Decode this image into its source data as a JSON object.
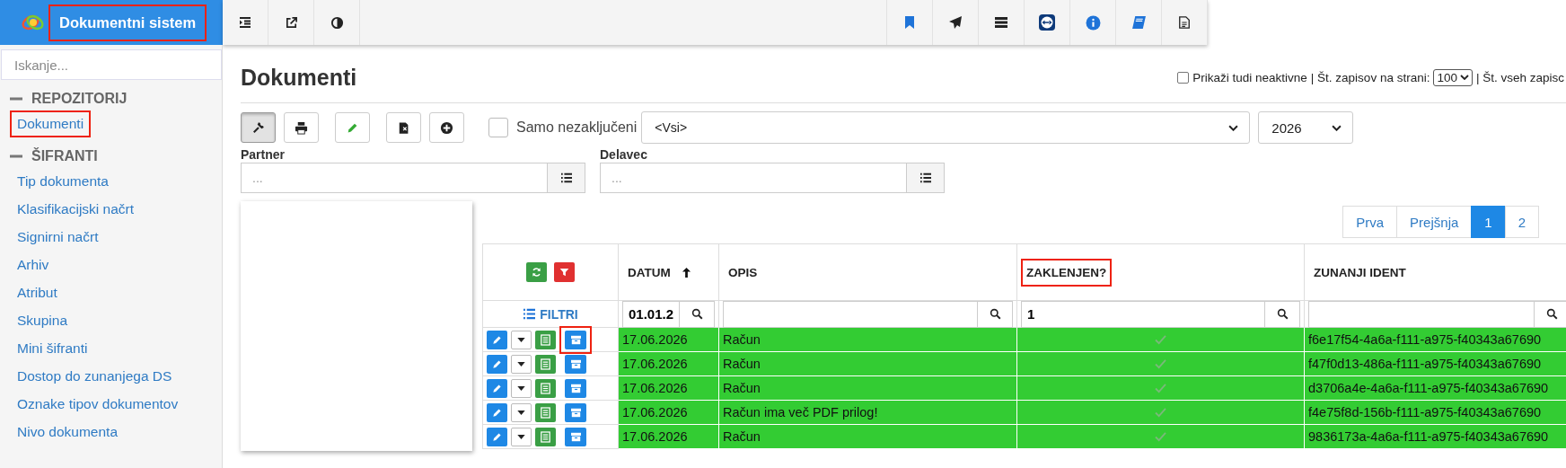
{
  "brand": {
    "title": "Dokumentni sistem",
    "highlighted": true
  },
  "sidebar": {
    "search_placeholder": "Iskanje...",
    "sections": [
      {
        "title": "REPOZITORIJ",
        "expanded": true,
        "items": [
          {
            "label": "Dokumenti",
            "highlighted": true
          }
        ]
      },
      {
        "title": "ŠIFRANTI",
        "expanded": true,
        "items": [
          {
            "label": "Tip dokumenta",
            "highlighted": false
          },
          {
            "label": "Klasifikacijski načrt",
            "highlighted": false
          },
          {
            "label": "Signirni načrt",
            "highlighted": false
          },
          {
            "label": "Arhiv",
            "highlighted": false
          },
          {
            "label": "Atribut",
            "highlighted": false
          },
          {
            "label": "Skupina",
            "highlighted": false
          },
          {
            "label": "Mini šifranti",
            "highlighted": false
          },
          {
            "label": "Dostop do zunanjega DS",
            "highlighted": false
          },
          {
            "label": "Oznake tipov dokumentov",
            "highlighted": false
          },
          {
            "label": "Nivo dokumenta",
            "highlighted": false
          }
        ]
      }
    ]
  },
  "page": {
    "title": "Dokumenti",
    "show_inactive": {
      "label": "Prikaži tudi neaktivne",
      "checked": false
    },
    "per_page_label": "| Št. zapisov na strani:",
    "per_page": "100",
    "total_label": "| Št. vseh zapisc"
  },
  "toolbar": {
    "only_unfinished": {
      "label": "Samo nezaključeni",
      "checked": false
    },
    "type_select": "<Vsi>",
    "year_select": "2026"
  },
  "filters": [
    {
      "label": "Partner",
      "placeholder": "..."
    },
    {
      "label": "Delavec",
      "placeholder": "..."
    }
  ],
  "pagination": [
    {
      "label": "Prva",
      "selected": false
    },
    {
      "label": "Prejšnja",
      "selected": false
    },
    {
      "label": "1",
      "selected": true
    },
    {
      "label": "2",
      "selected": false
    }
  ],
  "table": {
    "filter_label": "FILTRI",
    "columns": [
      {
        "label": "DATUM",
        "sort_ascending": true,
        "highlighted": false,
        "filter": "01.01.2"
      },
      {
        "label": "OPIS",
        "highlighted": false
      },
      {
        "label": "ZAKLENJEN?",
        "highlighted": true,
        "filter": "1"
      },
      {
        "label": "ZUNANJI IDENT",
        "highlighted": false
      }
    ],
    "rows": [
      {
        "date": "17.06.2026",
        "description": "Račun",
        "locked": true,
        "ident": "f6e17f54-4a6a-f111-a975-f40343a67690",
        "archive_highlighted": true
      },
      {
        "date": "17.06.2026",
        "description": "Račun",
        "locked": true,
        "ident": "f47f0d13-486a-f111-a975-f40343a67690",
        "archive_highlighted": false
      },
      {
        "date": "17.06.2026",
        "description": "Račun",
        "locked": true,
        "ident": "d3706a4e-4a6a-f111-a975-f40343a67690",
        "archive_highlighted": false
      },
      {
        "date": "17.06.2026",
        "description": "Račun ima več PDF prilog!",
        "locked": true,
        "ident": "f4e75f8d-156b-f111-a975-f40343a67690",
        "archive_highlighted": false
      },
      {
        "date": "17.06.2026",
        "description": "Račun",
        "locked": true,
        "ident": "9836173a-4a6a-f111-a975-f40343a67690",
        "archive_highlighted": false
      }
    ]
  }
}
